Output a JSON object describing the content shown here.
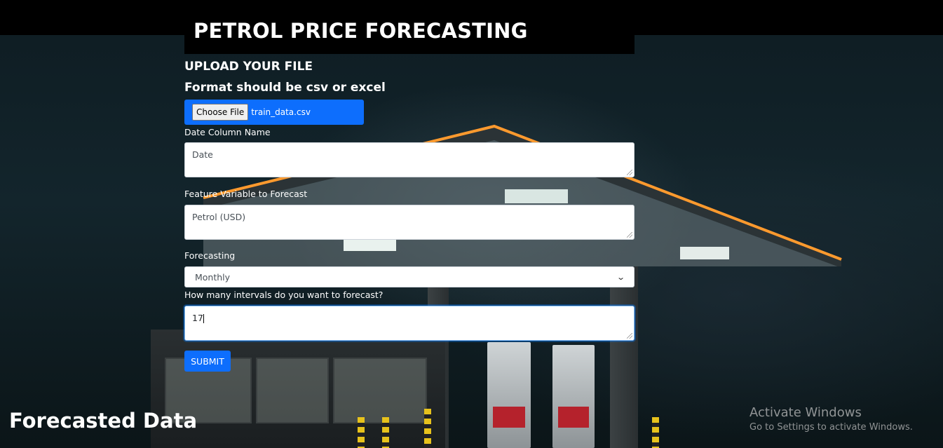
{
  "page": {
    "title": "PETROL PRICE FORECASTING"
  },
  "upload": {
    "heading": "UPLOAD YOUR FILE",
    "format_note": "Format should be csv or excel",
    "choose_file_label": "Choose File",
    "file_name": "train_data.csv"
  },
  "form": {
    "date_label": "Date Column Name",
    "date_value": "Date",
    "feature_label": "Feature Variable to Forecast",
    "feature_value": "Petrol (USD)",
    "forecasting_label": "Forecasting",
    "forecasting_selected": "Monthly",
    "intervals_label": "How many intervals do you want to forecast?",
    "intervals_value": "17",
    "submit_label": "SUBMIT"
  },
  "results": {
    "heading": "Forecasted Data"
  },
  "watermark": {
    "line1": "Activate Windows",
    "line2": "Go to Settings to activate Windows."
  },
  "colors": {
    "accent": "#0d6efd",
    "header_bg": "#000000"
  },
  "icons": {
    "select_arrow": "chevron-down-icon"
  }
}
